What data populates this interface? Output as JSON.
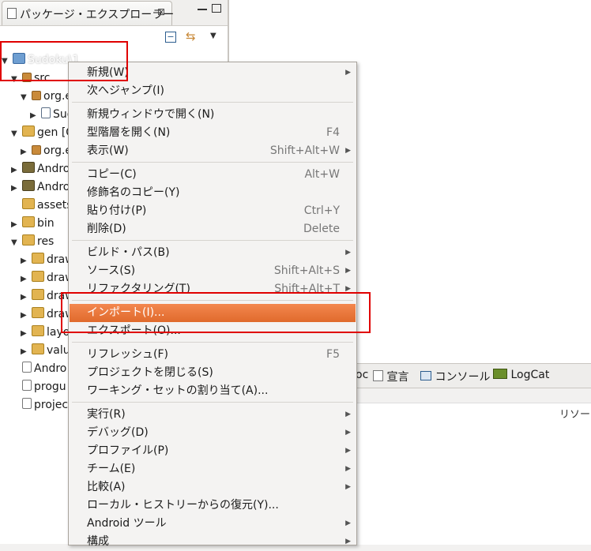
{
  "explorer": {
    "title": "パッケージ・エクスプローラー",
    "close": "⊠",
    "tree": [
      {
        "label": "Sudoku\\1",
        "arrow": "▼",
        "icon": "prj"
      },
      {
        "label": "src",
        "arrow": "▼",
        "icon": "pkg"
      },
      {
        "label": "org.e",
        "arrow": "▼",
        "icon": "pkg"
      },
      {
        "label": "Sud",
        "arrow": "▶",
        "icon": "jav"
      },
      {
        "label": "gen [G",
        "arrow": "▼",
        "icon": "fld"
      },
      {
        "label": "org.e",
        "arrow": "▶",
        "icon": "pkg"
      },
      {
        "label": "Andro",
        "arrow": "▶",
        "icon": "lib"
      },
      {
        "label": "Andro",
        "arrow": "▶",
        "icon": "lib"
      },
      {
        "label": "assets",
        "arrow": "",
        "icon": "fld"
      },
      {
        "label": "bin",
        "arrow": "▶",
        "icon": "fld"
      },
      {
        "label": "res",
        "arrow": "▼",
        "icon": "fld"
      },
      {
        "label": "draw",
        "arrow": "▶",
        "icon": "fld"
      },
      {
        "label": "draw",
        "arrow": "▶",
        "icon": "fld"
      },
      {
        "label": "draw",
        "arrow": "▶",
        "icon": "fld"
      },
      {
        "label": "draw",
        "arrow": "▶",
        "icon": "fld"
      },
      {
        "label": "layo",
        "arrow": "▶",
        "icon": "fld"
      },
      {
        "label": "valu",
        "arrow": "▶",
        "icon": "fld"
      },
      {
        "label": "Andro",
        "arrow": "",
        "icon": "fil"
      },
      {
        "label": "progu",
        "arrow": "",
        "icon": "fil"
      },
      {
        "label": "projec",
        "arrow": "",
        "icon": "fil"
      }
    ]
  },
  "bottom_tabs": [
    "oc",
    "宣言",
    "コンソール",
    "LogCat"
  ],
  "bottom_view_header": "リソー",
  "menu": [
    {
      "label": "新規(W)",
      "accel": "",
      "sub": true
    },
    {
      "label": "次へジャンプ(I)",
      "accel": "",
      "sub": false
    },
    {
      "label": "新規ウィンドウで開く(N)",
      "accel": "",
      "sub": false
    },
    {
      "label": "型階層を開く(N)",
      "accel": "F4",
      "sub": false
    },
    {
      "label": "表示(W)",
      "accel": "Shift+Alt+W",
      "sub": true
    },
    {
      "label": "コピー(C)",
      "accel": "Alt+W",
      "sub": false
    },
    {
      "label": "修飾名のコピー(Y)",
      "accel": "",
      "sub": false
    },
    {
      "label": "貼り付け(P)",
      "accel": "Ctrl+Y",
      "sub": false
    },
    {
      "label": "削除(D)",
      "accel": "Delete",
      "sub": false
    },
    {
      "label": "ビルド・パス(B)",
      "accel": "",
      "sub": true
    },
    {
      "label": "ソース(S)",
      "accel": "Shift+Alt+S",
      "sub": true
    },
    {
      "label": "リファクタリング(T)",
      "accel": "Shift+Alt+T",
      "sub": true
    },
    {
      "label": "インポート(I)...",
      "accel": "",
      "sub": false
    },
    {
      "label": "エクスポート(O)...",
      "accel": "",
      "sub": false
    },
    {
      "label": "リフレッシュ(F)",
      "accel": "F5",
      "sub": false
    },
    {
      "label": "プロジェクトを閉じる(S)",
      "accel": "",
      "sub": false
    },
    {
      "label": "ワーキング・セットの割り当て(A)...",
      "accel": "",
      "sub": false
    },
    {
      "label": "実行(R)",
      "accel": "",
      "sub": true
    },
    {
      "label": "デバッグ(D)",
      "accel": "",
      "sub": true
    },
    {
      "label": "プロファイル(P)",
      "accel": "",
      "sub": true
    },
    {
      "label": "チーム(E)",
      "accel": "",
      "sub": true
    },
    {
      "label": "比較(A)",
      "accel": "",
      "sub": true
    },
    {
      "label": "ローカル・ヒストリーからの復元(Y)...",
      "accel": "",
      "sub": false
    },
    {
      "label": "Android ツール",
      "accel": "",
      "sub": true
    },
    {
      "label": "構成",
      "accel": "",
      "sub": true
    }
  ],
  "highlight_color": "#e8733a",
  "annotation_color": "#e00000"
}
